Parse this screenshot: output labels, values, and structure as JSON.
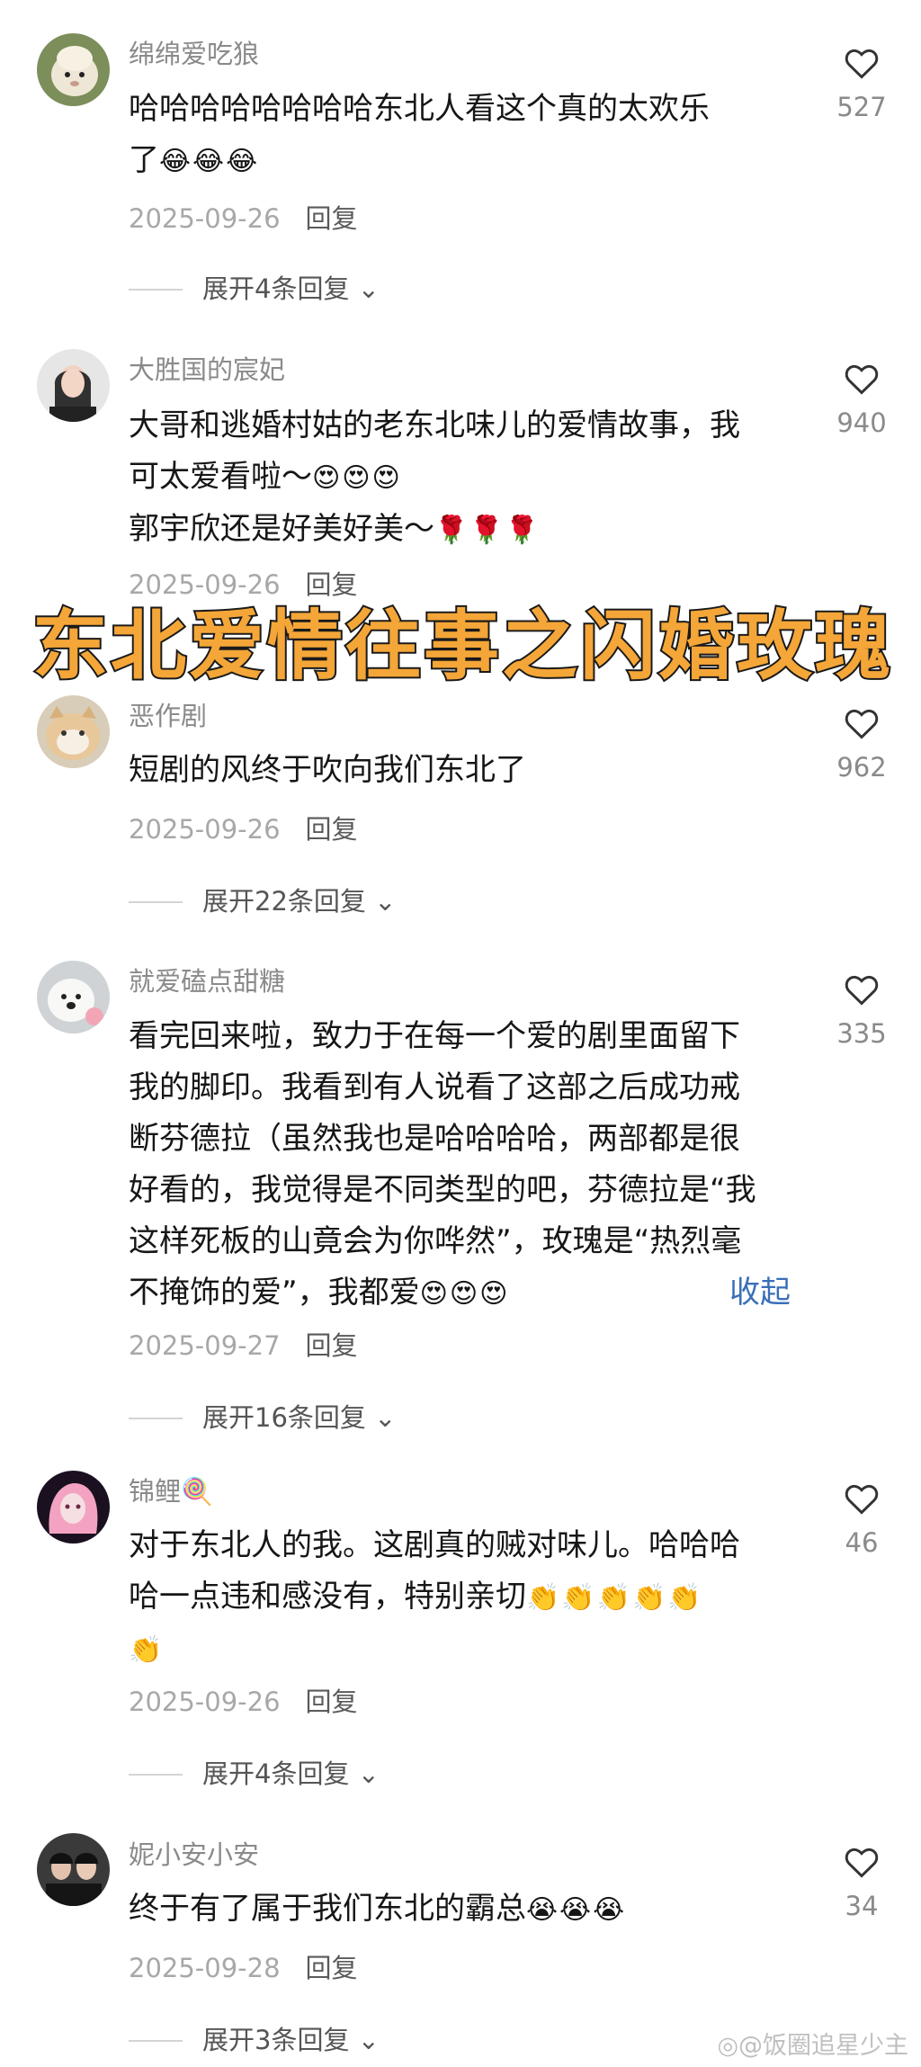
{
  "comments": [
    {
      "username": "绵绵爱吃狼",
      "lines": [
        "哈哈哈哈哈哈哈哈东北人看这个真的太欢乐",
        "了"
      ],
      "line_emojis": [
        "",
        "😂😂😂"
      ],
      "date": "2025-09-26",
      "reply_label": "回复",
      "expand_label": "展开4条回复",
      "likes": "527"
    },
    {
      "username": "大胜国的宸妃",
      "lines": [
        "大哥和逃婚村姑的老东北味儿的爱情故事，我",
        "可太爱看啦～",
        "郭宇欣还是好美好美～"
      ],
      "line_emojis": [
        "",
        "😍😍😍",
        "🌹🌹🌹"
      ],
      "date": "2025-09-26",
      "reply_label": "回复",
      "likes": "940"
    },
    {
      "username": "恶作剧",
      "lines": [
        "短剧的风终于吹向我们东北了"
      ],
      "line_emojis": [
        ""
      ],
      "date": "2025-09-26",
      "reply_label": "回复",
      "expand_label": "展开22条回复",
      "likes": "962"
    },
    {
      "username": "就爱磕点甜糖",
      "lines": [
        "看完回来啦，致力于在每一个爱的剧里面留下",
        "我的脚印。我看到有人说看了这部之后成功戒",
        "断芬德拉（虽然我也是哈哈哈哈，两部都是很",
        "好看的，我觉得是不同类型的吧，芬德拉是“我",
        "这样死板的山竟会为你哗然”，玫瑰是“热烈毫",
        "不掩饰的爱”，我都爱"
      ],
      "line_emojis": [
        "",
        "",
        "",
        "",
        "",
        "😍😍😍"
      ],
      "collapse_label": "收起",
      "date": "2025-09-27",
      "reply_label": "回复",
      "expand_label": "展开16条回复",
      "likes": "335"
    },
    {
      "username": "锦鲤🍭",
      "lines": [
        "对于东北人的我。这剧真的贼对味儿。哈哈哈",
        "哈一点违和感没有，特别亲切",
        ""
      ],
      "line_emojis": [
        "",
        "👏👏👏👏👏",
        "👏"
      ],
      "date": "2025-09-26",
      "reply_label": "回复",
      "expand_label": "展开4条回复",
      "likes": "46"
    },
    {
      "username": "妮小安小安",
      "lines": [
        "终于有了属于我们东北的霸总"
      ],
      "line_emojis": [
        "😭😭😭"
      ],
      "date": "2025-09-28",
      "reply_label": "回复",
      "expand_label": "展开3条回复",
      "likes": "34"
    }
  ],
  "overlay_title": "东北爱情往事之闪婚玫瑰",
  "watermark": "@饭圈追星少主",
  "colors": {
    "accent_link": "#3a6fb8",
    "overlay_fill": "#f4a638",
    "username": "#8a8a8a"
  },
  "icons": {
    "like": "heart-outline-icon",
    "expand": "chevron-down-icon",
    "weibo": "weibo-logo-icon"
  }
}
